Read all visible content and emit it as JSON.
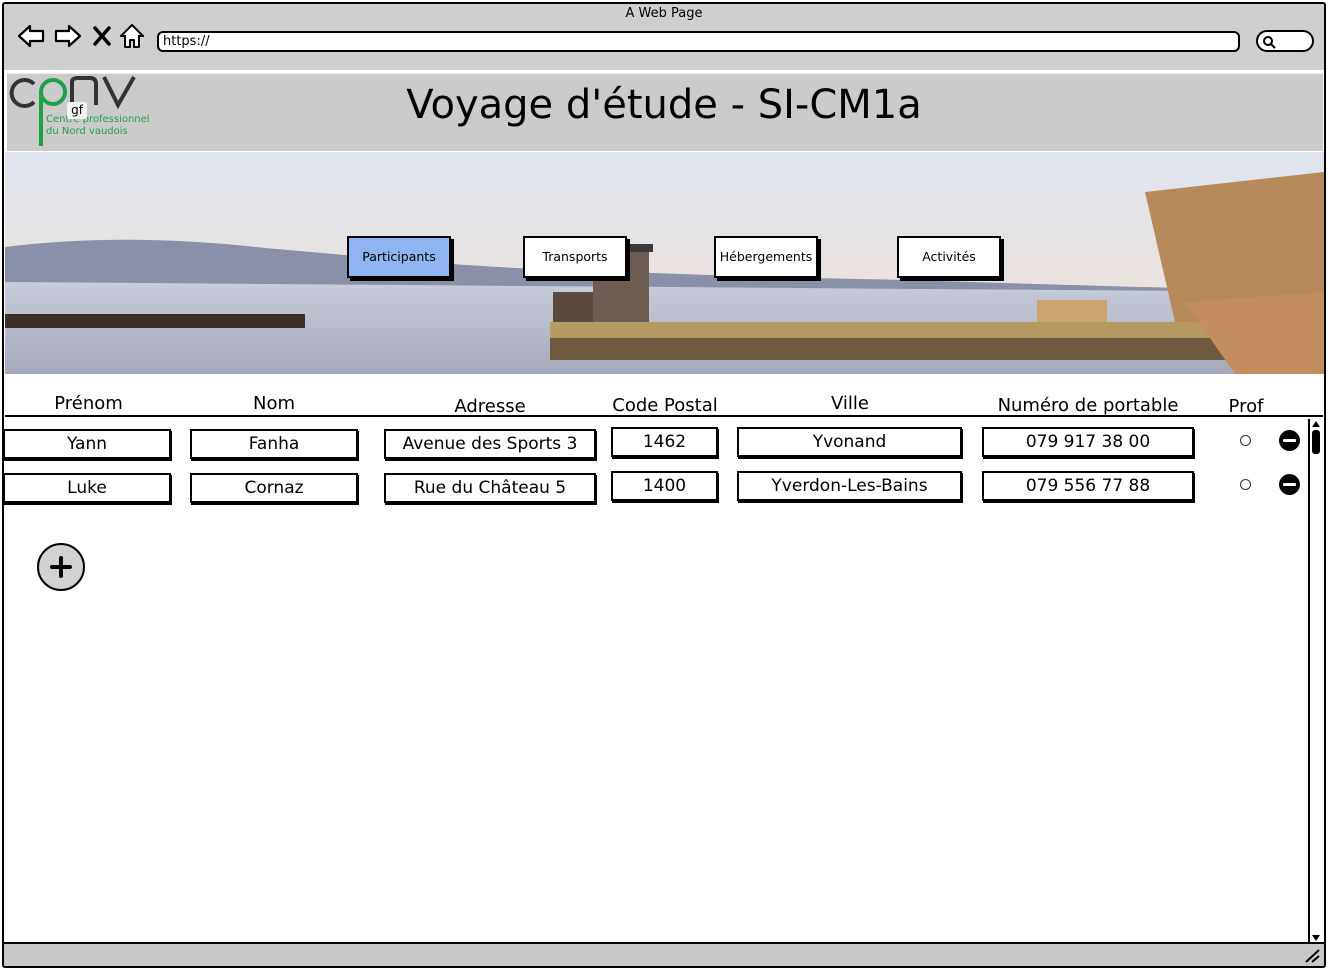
{
  "browser": {
    "window_title": "A Web Page",
    "url": "https://"
  },
  "header": {
    "logo_text": "cpnv",
    "logo_sub1": "Centre professionnel",
    "logo_sub2": "du Nord vaudois",
    "logo_badge": "gf",
    "title": "Voyage d'étude - SI-CM1a"
  },
  "nav": [
    {
      "label": "Participants",
      "active": true
    },
    {
      "label": "Transports",
      "active": false
    },
    {
      "label": "Hébergements",
      "active": false
    },
    {
      "label": "Activités",
      "active": false
    }
  ],
  "table": {
    "columns": [
      "Prénom",
      "Nom",
      "Adresse",
      "Code Postal",
      "Ville",
      "Numéro de portable",
      "Prof"
    ],
    "rows": [
      {
        "prenom": "Yann",
        "nom": "Fanha",
        "adresse": "Avenue des Sports 3",
        "code_postal": "1462",
        "ville": "Yvonand",
        "portable": "079 917 38 00",
        "prof": false
      },
      {
        "prenom": "Luke",
        "nom": "Cornaz",
        "adresse": "Rue du Château 5",
        "code_postal": "1400",
        "ville": "Yverdon-Les-Bains",
        "portable": "079 556 77 88",
        "prof": false
      }
    ]
  },
  "colors": {
    "active_tab": "#8fb4f2",
    "header_bg": "#cbcbcb",
    "logo_green": "#1fa04a"
  },
  "icons": [
    "back-icon",
    "forward-icon",
    "close-icon",
    "home-icon",
    "search-icon",
    "remove-row-icon",
    "add-row-icon",
    "resize-grip-icon"
  ]
}
